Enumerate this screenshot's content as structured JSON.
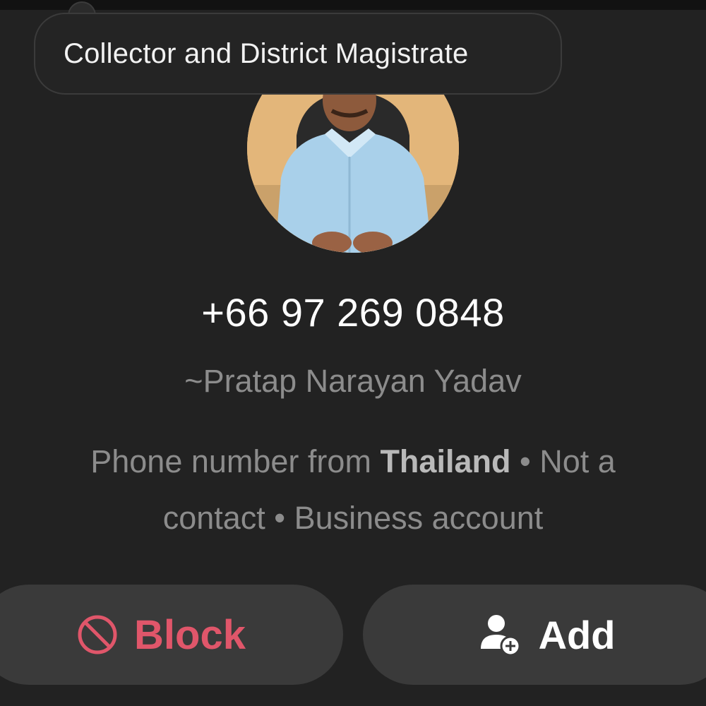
{
  "tooltip": {
    "text": "Collector and District Magistrate"
  },
  "profile": {
    "phone_number": "+66 97 269 0848",
    "display_name": "~Pratap Narayan Yadav",
    "info_prefix": "Phone number from ",
    "info_country": "Thailand",
    "info_line1_suffix": " • Not a",
    "info_line2": "contact • Business account"
  },
  "actions": {
    "block_label": "Block",
    "add_label": "Add",
    "block_icon": "block-circle-icon",
    "add_icon": "add-person-icon",
    "block_color": "#e0566a"
  }
}
